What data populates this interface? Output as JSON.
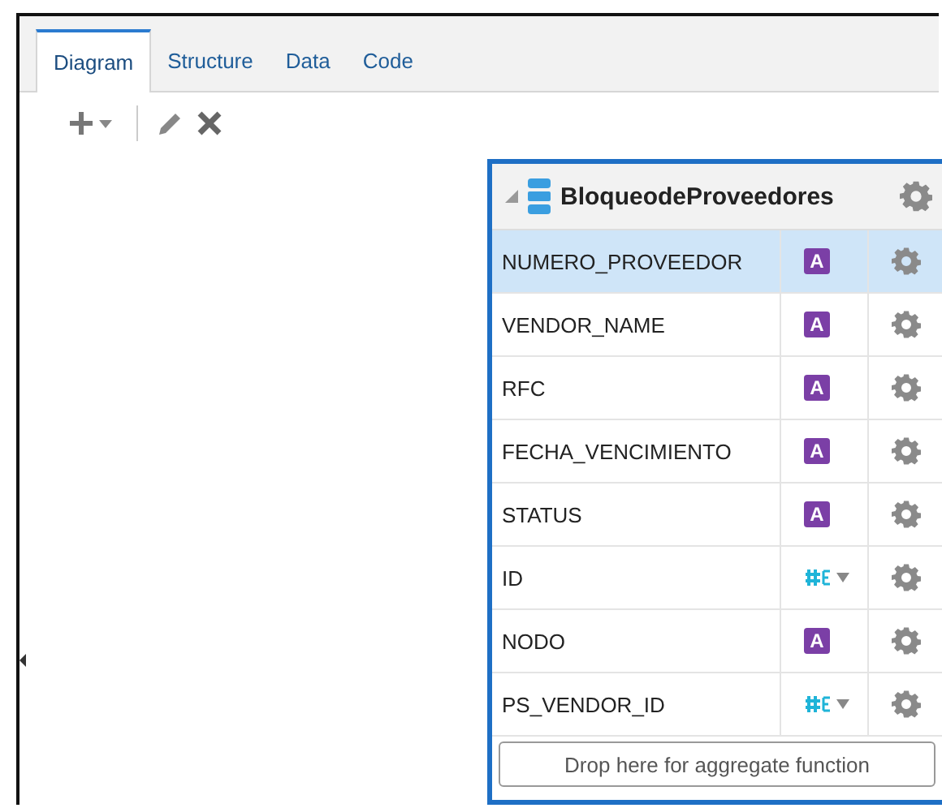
{
  "tabs": [
    {
      "label": "Diagram",
      "selected": true
    },
    {
      "label": "Structure",
      "selected": false
    },
    {
      "label": "Data",
      "selected": false
    },
    {
      "label": "Code",
      "selected": false
    }
  ],
  "entity": {
    "title": "BloqueodeProveedores",
    "expanded": true,
    "columns": [
      {
        "name": "NUMERO_PROVEEDOR",
        "kind": "text",
        "badge": "A",
        "selected": true
      },
      {
        "name": "VENDOR_NAME",
        "kind": "text",
        "badge": "A",
        "selected": false
      },
      {
        "name": "RFC",
        "kind": "text",
        "badge": "A",
        "selected": false
      },
      {
        "name": "FECHA_VENCIMIENTO",
        "kind": "text",
        "badge": "A",
        "selected": false
      },
      {
        "name": "STATUS",
        "kind": "text",
        "badge": "A",
        "selected": false
      },
      {
        "name": "ID",
        "kind": "number",
        "selected": false
      },
      {
        "name": "NODO",
        "kind": "text",
        "badge": "A",
        "selected": false
      },
      {
        "name": "PS_VENDOR_ID",
        "kind": "number",
        "selected": false
      }
    ],
    "drop_zone": "Drop here for aggregate function"
  }
}
